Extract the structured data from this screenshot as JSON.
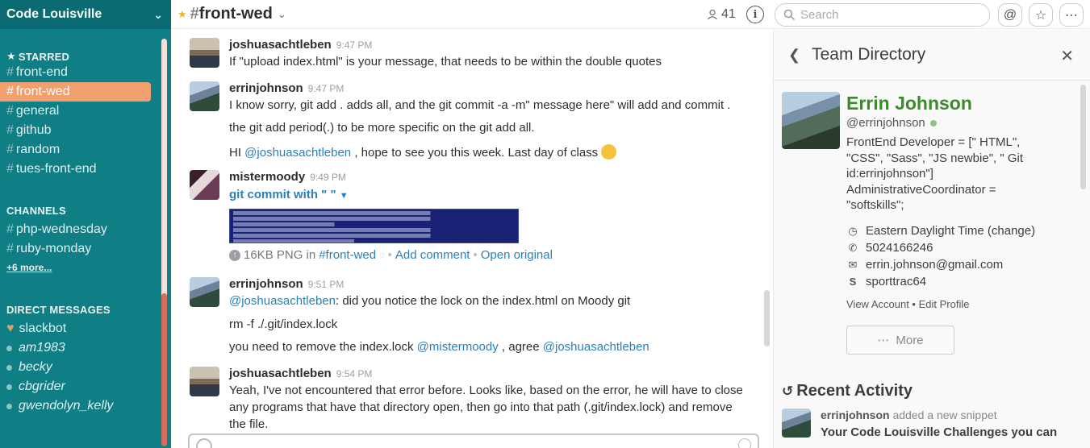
{
  "team": {
    "name": "Code Louisville"
  },
  "sidebar": {
    "starred_label": "STARRED",
    "starred": [
      {
        "name": "front-end"
      },
      {
        "name": "front-wed"
      },
      {
        "name": "general"
      },
      {
        "name": "github"
      },
      {
        "name": "random"
      },
      {
        "name": "tues-front-end"
      }
    ],
    "channels_label": "CHANNELS",
    "channels": [
      {
        "name": "php-wednesday"
      },
      {
        "name": "ruby-monday"
      }
    ],
    "more_label": "+6 more...",
    "dm_label": "DIRECT MESSAGES",
    "dms": [
      {
        "name": "slackbot"
      },
      {
        "name": "am1983"
      },
      {
        "name": "becky"
      },
      {
        "name": "cbgrider"
      },
      {
        "name": "gwendolyn_kelly"
      }
    ]
  },
  "header": {
    "channel": "front-wed",
    "member_count": "41",
    "search_placeholder": "Search"
  },
  "messages": [
    {
      "user": "joshuasachtleben",
      "time": "9:47 PM",
      "lines": [
        "If \"upload index.html\" is your message, that needs to be within the double quotes"
      ]
    },
    {
      "user": "errinjohnson",
      "time": "9:47 PM",
      "line1": "I know sorry, git add . adds all, and the git commit -a -m\" message here\" will add and commit .",
      "line2": "the git add period(.) to be more specific on the git add all.",
      "line3_pre": "HI ",
      "line3_mention": "@joshuasachtleben",
      "line3_post": " , hope to see you this week.  Last day of class"
    },
    {
      "user": "mistermoody",
      "time": "9:49 PM",
      "file_title": "git commit with \" \"",
      "file_size": "16KB PNG in ",
      "file_channel": "#front-wed",
      "add_comment": "Add comment",
      "open_original": "Open original"
    },
    {
      "user": "errinjohnson",
      "time": "9:51 PM",
      "line1_mention": "@joshuasachtleben",
      "line1_post": ": did you notice the lock on the index.html on Moody git",
      "line2": "rm -f ./.git/index.lock",
      "line3_pre": "you need to remove the index.lock ",
      "line3_mention1": "@mistermoody",
      "line3_mid": " , agree ",
      "line3_mention2": "@joshuasachtleben"
    },
    {
      "user": "joshuasachtleben",
      "time": "9:54 PM",
      "line1": "Yeah, I've not encountered that error before.  Looks like, based on the error, he will have to close",
      "line2": "any programs that have that directory open, then go into that path (.git/index.lock) and remove",
      "line3": "the file."
    }
  ],
  "panel": {
    "title": "Team Directory",
    "name": "Errin Johnson",
    "handle": "@errinjohnson",
    "bio": "FrontEnd Developer = [\" HTML\", \"CSS\", \"Sass\", \"JS newbie\", \" Git id:errinjohnson\"] AdministrativeCoordinator = \"softskills\";",
    "timezone": "Eastern Daylight Time (change)",
    "phone": "5024166246",
    "email": "errin.johnson@gmail.com",
    "skype": "sporttrac64",
    "links": "View Account • Edit Profile",
    "more": "More",
    "recent_title": "Recent Activity",
    "recent_user": "errinjohnson",
    "recent_action": " added a new snippet",
    "recent_snippet": "Your Code Louisville Challenges you can"
  },
  "colors": {
    "sidebar": "#0f7e85",
    "active": "#f19f6f",
    "link": "#2a80b9",
    "name": "#3b8a2c"
  }
}
